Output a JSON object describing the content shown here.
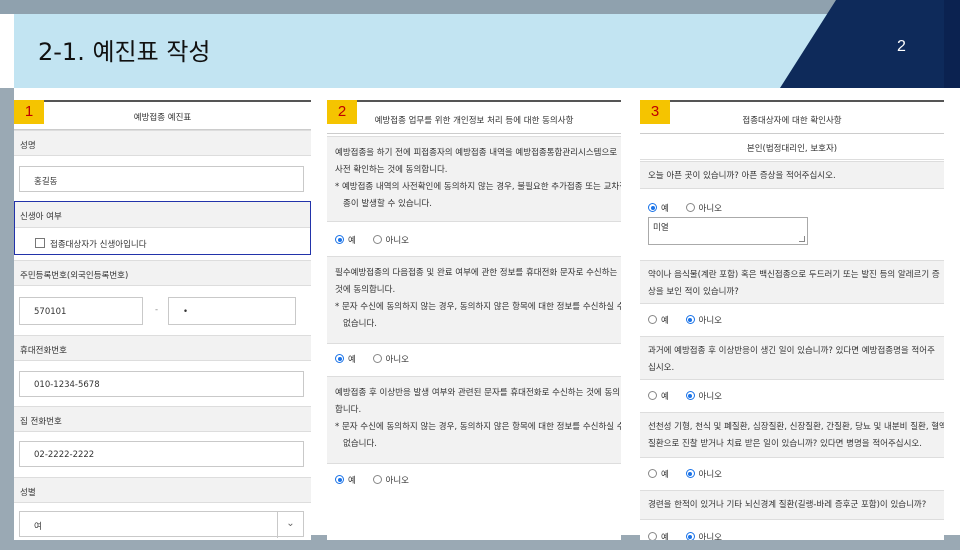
{
  "slide": {
    "title": "2-1. 예진표 작성",
    "page_number": "2",
    "colors": {
      "header_bg": "#c2e4f2",
      "corner_navy": "#0e2a5a",
      "badge": "#f5c400",
      "badge_text": "#c00000",
      "radio_blue": "#1a73e8",
      "highlight_border": "#2233aa"
    }
  },
  "panel1": {
    "badge": "1",
    "header": "예방접종 예진표",
    "name_label": "성명",
    "name_value": "홍길동",
    "newborn_label": "신생아 여부",
    "newborn_checkbox_label": "접종대상자가 신생아입니다",
    "rrn_label": "주민등록번호(외국인등록번호)",
    "rrn_front": "570101",
    "rrn_dash": "-",
    "rrn_back": "•",
    "mobile_label": "휴대전화번호",
    "mobile_value": "010-1234-5678",
    "home_label": "집 전화번호",
    "home_value": "02-2222-2222",
    "gender_label": "성별",
    "gender_value": "여",
    "chevron_icon": "chevron-down-icon"
  },
  "panel2": {
    "badge": "2",
    "header": "예방접종 업무를 위한 개인정보 처리 등에 대한 동의사항",
    "consent1_lines": [
      "예방접종을 하기 전에 피접종자의 예방접종 내역을 예방접종통합관리시스템으로",
      "사전 확인하는 것에 동의합니다.",
      "* 예방접종 내역의 사전확인에 동의하지 않는 경우, 불필요한 추가접종 또는 교차접",
      "종이 발생할 수 있습니다."
    ],
    "consent2_lines": [
      "필수예방접종의 다음접종 및 완료 여부에 관한 정보를 휴대전화 문자로 수신하는",
      "것에 동의합니다.",
      "* 문자 수신에 동의하지 않는 경우, 동의하지 않은 항목에 대한 정보를 수신하실 수",
      "없습니다."
    ],
    "consent3_lines": [
      "예방접종 후 이상반응 발생 여부와 관련된 문자를 휴대전화로 수신하는 것에 동의",
      "합니다.",
      "* 문자 수신에 동의하지 않는 경우, 동의하지 않은 항목에 대한 정보를 수신하실 수",
      "없습니다."
    ],
    "yes": "예",
    "no": "아니오"
  },
  "panel3": {
    "badge": "3",
    "header": "접종대상자에 대한 확인사항",
    "subheader": "본인(법정대리인, 보호자)",
    "q1": "오늘 아픈 곳이 있습니까? 아픈 증상을 적어주십시오.",
    "q1_answer": "미열",
    "q2_lines": [
      "약이나 음식물(계란 포함) 혹은 백신접종으로 두드러기 또는 발진 등의 알레르기 증",
      "상을 보인 적이 있습니까?"
    ],
    "q3_lines": [
      "과거에 예방접종 후 이상반응이 생긴 일이 있습니까? 있다면 예방접종명을 적어주",
      "십시오."
    ],
    "q4_lines": [
      "선천성 기형, 천식 및 폐질환, 심장질환, 신장질환, 간질환, 당뇨 및 내분비 질환, 혈액",
      "질환으로 진찰 받거나 치료 받은 일이 있습니까? 있다면 병명을 적어주십시오."
    ],
    "q5": "경련을 한적이 있거나 기타 뇌신경계 질환(길랭-바레 증후군 포함)이 있습니까?",
    "yes": "예",
    "no": "아니오"
  }
}
